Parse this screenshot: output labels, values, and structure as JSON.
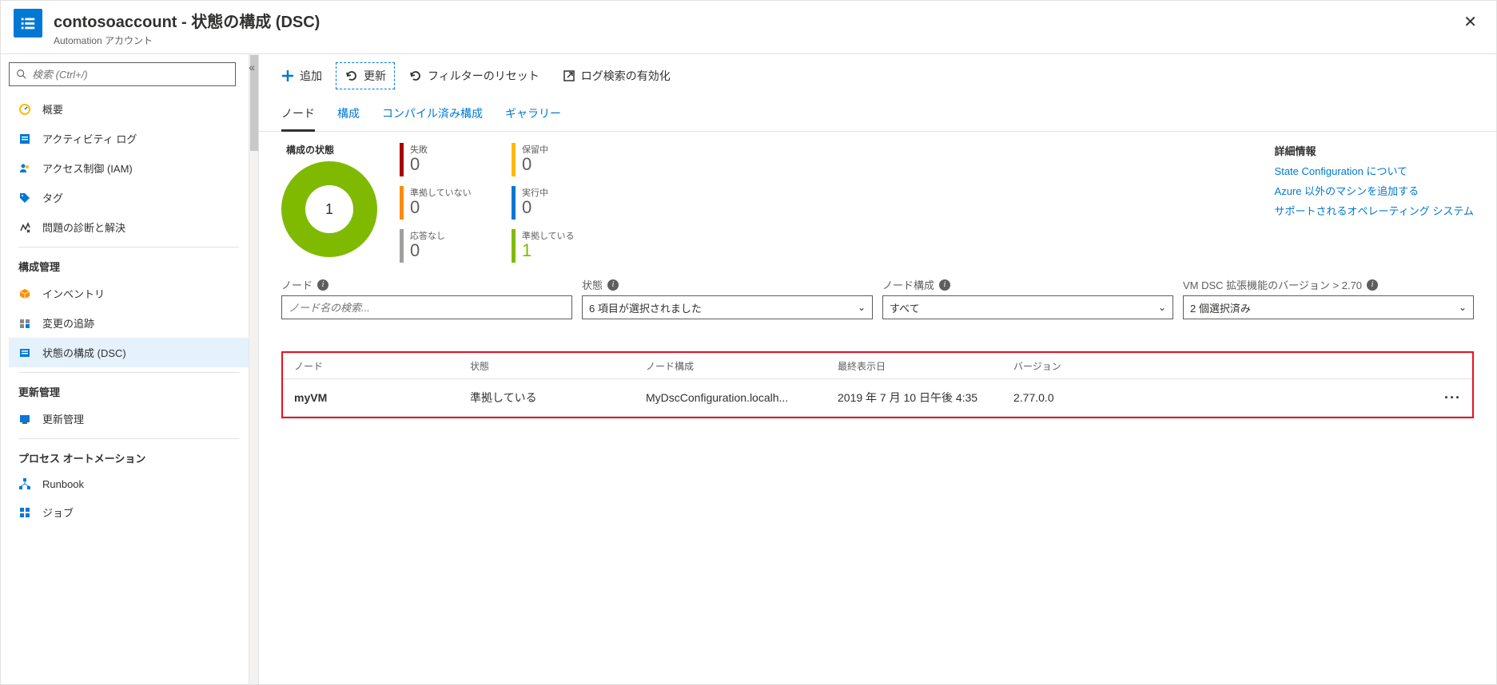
{
  "header": {
    "title": "contosoaccount - 状態の構成 (DSC)",
    "subtitle": "Automation アカウント"
  },
  "sidebar": {
    "search_placeholder": "検索 (Ctrl+/)",
    "items_top": [
      {
        "label": "概要",
        "icon": "overview"
      },
      {
        "label": "アクティビティ ログ",
        "icon": "activity"
      },
      {
        "label": "アクセス制御 (IAM)",
        "icon": "iam"
      },
      {
        "label": "タグ",
        "icon": "tag"
      },
      {
        "label": "問題の診断と解決",
        "icon": "diag"
      }
    ],
    "section_config": "構成管理",
    "items_config": [
      {
        "label": "インベントリ",
        "icon": "inventory"
      },
      {
        "label": "変更の追跡",
        "icon": "track"
      },
      {
        "label": "状態の構成 (DSC)",
        "icon": "dsc",
        "selected": true
      }
    ],
    "section_update": "更新管理",
    "items_update": [
      {
        "label": "更新管理",
        "icon": "update"
      }
    ],
    "section_proc": "プロセス オートメーション",
    "items_proc": [
      {
        "label": "Runbook",
        "icon": "runbook"
      },
      {
        "label": "ジョブ",
        "icon": "job"
      }
    ]
  },
  "toolbar": {
    "add": "追加",
    "refresh": "更新",
    "reset": "フィルターのリセット",
    "log": "ログ検索の有効化"
  },
  "tabs": [
    "ノード",
    "構成",
    "コンパイル済み構成",
    "ギャラリー"
  ],
  "summary": {
    "title": "構成の状態",
    "donut_value": "1",
    "stats": [
      {
        "label": "失敗",
        "value": "0",
        "color": "#a80000"
      },
      {
        "label": "保留中",
        "value": "0",
        "color": "#ffb900"
      },
      {
        "label": "準拠していない",
        "value": "0",
        "color": "#ff8c00"
      },
      {
        "label": "実行中",
        "value": "0",
        "color": "#0078d4"
      },
      {
        "label": "応答なし",
        "value": "0",
        "color": "#a19f9d"
      },
      {
        "label": "準拠している",
        "value": "1",
        "color": "#7fba00",
        "highlight": true
      }
    ]
  },
  "info": {
    "title": "詳細情報",
    "links": [
      "State Configuration について",
      "Azure 以外のマシンを追加する",
      "サポートされるオペレーティング システム"
    ]
  },
  "filters": {
    "node_label": "ノード",
    "node_placeholder": "ノード名の検索...",
    "status_label": "状態",
    "status_value": "6 項目が選択されました",
    "config_label": "ノード構成",
    "config_value": "すべて",
    "ver_label": "VM DSC 拡張機能のバージョン > 2.70",
    "ver_value": "2 個選択済み"
  },
  "table": {
    "headers": [
      "ノード",
      "状態",
      "ノード構成",
      "最終表示日",
      "バージョン"
    ],
    "rows": [
      {
        "node": "myVM",
        "status": "準拠している",
        "config": "MyDscConfiguration.localh...",
        "last": "2019 年 7 月 10 日午後 4:35",
        "ver": "2.77.0.0"
      }
    ]
  }
}
